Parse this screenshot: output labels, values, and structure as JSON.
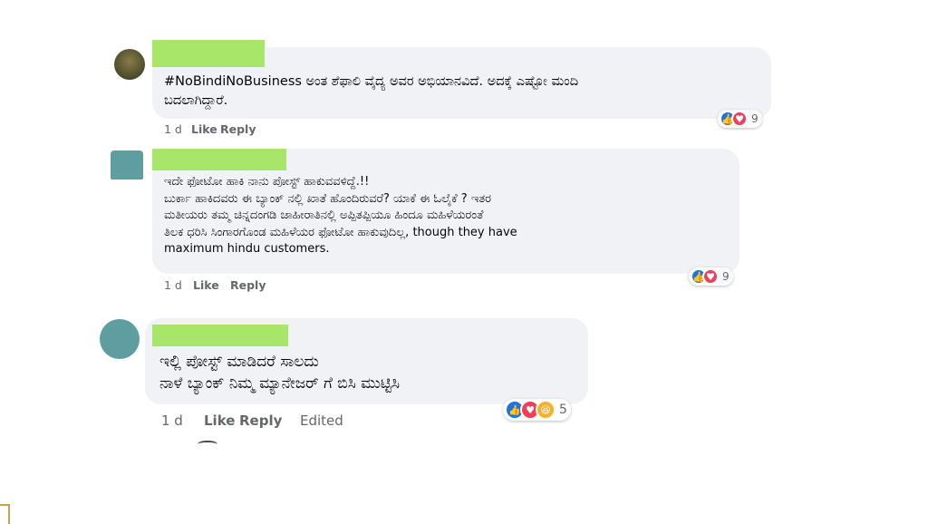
{
  "colors": {
    "bubble": "#f0f2f5",
    "name_redaction": "#a8e66a",
    "avatar_redaction": "#5f9ea0",
    "like_blue": "#1b74e4",
    "love_red": "#f33e58",
    "haha_yellow": "#f7b125",
    "meta_gray": "#65676b"
  },
  "comments": [
    {
      "text": "#NoBindiNoBusiness ಅಂತ ಶೆಫಾಲಿ ವೈದ್ಯ ಅವರ ಅಭಿಯಾನವಿದೆ. ಅದಕ್ಕೆ ಎಷ್ಟೋ ಮಂದಿ\nಬದಲಾಗಿದ್ದಾರೆ.",
      "time": "1 d",
      "like": "Like",
      "reply": "Reply",
      "reactions": [
        "like-icon",
        "love-icon"
      ],
      "reaction_count": "9"
    },
    {
      "text": "ಇದೇ ಫೋಟೋ ಹಾಕಿ ನಾನು ಪೋಸ್ಟ್ ಹಾಕುವವಳಿದ್ದೆ.!!\nಬುರ್ಕಾ ಹಾಕಿದವರು ಈ ಬ್ಯಾಂಕ್ ನಲ್ಲಿ ಖಾತೆ ಹೊಂದಿರುವರೆ? ಯಾಕೆ ಈ ಓಲೈಕೆ ? ಇತರ\nಮತೀಯರು ತಮ್ಮ ಚಿನ್ನದಂಗಡಿ ಜಾಹೀರಾತಿನಲ್ಲಿ ಅಪ್ಪಿತಪ್ಪಿಯೂ ಹಿಂದೂ ಮಹಿಳೆಯರಂತೆ\nತಿಲಕ ಧರಿಸಿ ಸಿಂಗಾರಗೊಂಡ ಮಹಿಳೆಯರ ಫೋಟೋ ಹಾಕುವುದಿಲ್ಲ, though they have\nmaximum hindu customers.",
      "time": "1 d",
      "like": "Like",
      "reply": "Reply",
      "reactions": [
        "like-icon",
        "love-icon"
      ],
      "reaction_count": "9"
    },
    {
      "text": "ಇಲ್ಲಿ ಪೋಸ್ಟ್ ಮಾಡಿದರೆ ಸಾಲದು\nನಾಳೆ ಬ್ಯಾಂಕ್ ನಿಮ್ಮ ಮ್ಯಾನೇಜರ್ ಗೆ ಬಿಸಿ ಮುಟ್ಟಿಸಿ",
      "time": "1 d",
      "like": "Like",
      "reply": "Reply",
      "edited": "Edited",
      "reactions": [
        "like-icon",
        "love-icon",
        "haha-icon"
      ],
      "reaction_count": "5"
    }
  ]
}
